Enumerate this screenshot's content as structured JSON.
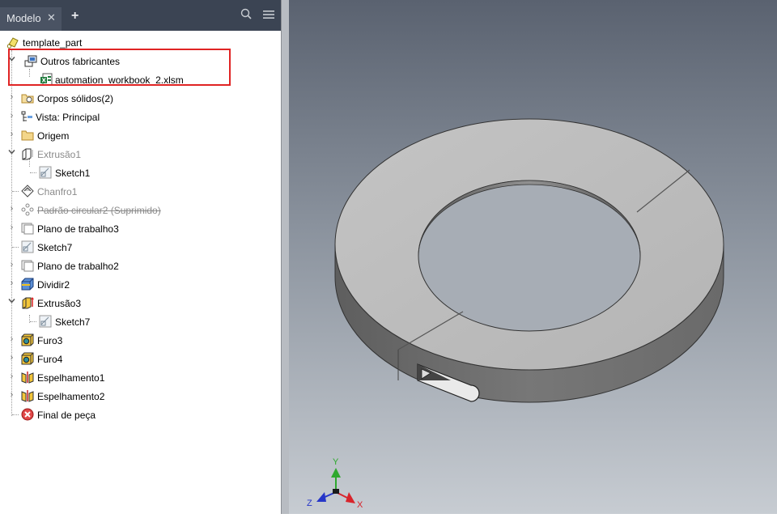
{
  "browser": {
    "tab_label": "Modelo",
    "close_glyph": "✕",
    "add_glyph": "+",
    "search_icon": "⌕",
    "menu_icon": "☰"
  },
  "tree": [
    {
      "label": "template_part",
      "icon": "part-icon",
      "state": "normal"
    },
    {
      "label": "Outros fabricantes",
      "icon": "third-party-icon",
      "state": "normal",
      "expanded": true
    },
    {
      "label": "automation_workbook_2.xlsm",
      "icon": "excel-workbook-icon",
      "state": "normal"
    },
    {
      "label": "Corpos sólidos(2)",
      "icon": "solid-bodies-icon",
      "state": "normal"
    },
    {
      "label": "Vista: Principal",
      "icon": "view-icon",
      "state": "normal"
    },
    {
      "label": "Origem",
      "icon": "folder-icon",
      "state": "normal"
    },
    {
      "label": "Extrusão1",
      "icon": "extrude-icon",
      "state": "dim",
      "expanded": true
    },
    {
      "label": "Sketch1",
      "icon": "sketch-icon",
      "state": "normal"
    },
    {
      "label": "Chanfro1",
      "icon": "chamfer-icon",
      "state": "dim"
    },
    {
      "label": "Padrão circular2 (Suprimido)",
      "icon": "circular-pattern-icon",
      "state": "suppressed"
    },
    {
      "label": "Plano de trabalho3",
      "icon": "work-plane-icon",
      "state": "normal"
    },
    {
      "label": "Sketch7",
      "icon": "sketch-icon",
      "state": "normal"
    },
    {
      "label": "Plano de trabalho2",
      "icon": "work-plane-icon",
      "state": "normal"
    },
    {
      "label": "Dividir2",
      "icon": "split-icon",
      "state": "normal"
    },
    {
      "label": "Extrusão3",
      "icon": "extrude-icon",
      "state": "normal",
      "expanded": true
    },
    {
      "label": "Sketch7",
      "icon": "sketch-icon",
      "state": "normal"
    },
    {
      "label": "Furo3",
      "icon": "hole-icon",
      "state": "normal"
    },
    {
      "label": "Furo4",
      "icon": "hole-icon",
      "state": "normal"
    },
    {
      "label": "Espelhamento1",
      "icon": "mirror-icon",
      "state": "normal"
    },
    {
      "label": "Espelhamento2",
      "icon": "mirror-icon",
      "state": "normal"
    },
    {
      "label": "Final de peça",
      "icon": "end-of-part-icon",
      "state": "normal"
    }
  ],
  "viewcube": {
    "x_label": "X",
    "y_label": "Y",
    "z_label": "Z",
    "colors": {
      "x": "#d8242b",
      "y": "#2ea82e",
      "z": "#2636c8"
    }
  },
  "colors": {
    "tabbar": "#3b4453",
    "highlight": "#e02424",
    "part_top": "#bdbdbd",
    "part_side": "#6b6b6b"
  }
}
